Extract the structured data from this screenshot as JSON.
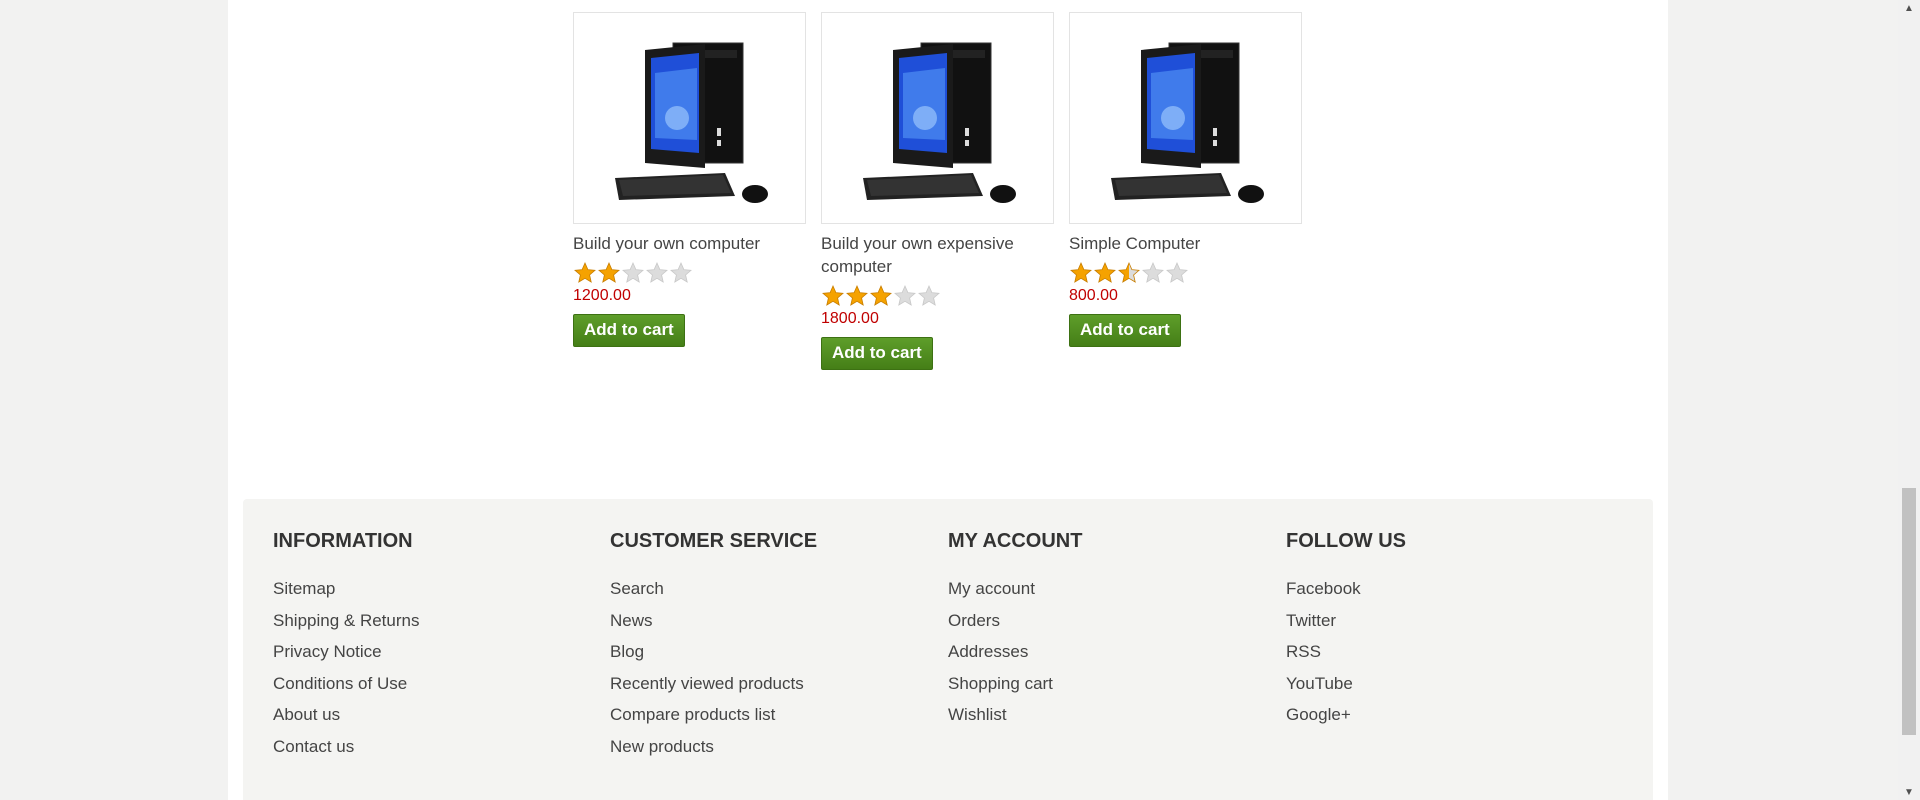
{
  "products": [
    {
      "title": "Build your own computer",
      "rating_fraction": 0.4,
      "price": "1200.00",
      "add_label": "Add to cart"
    },
    {
      "title": "Build your own expensive computer",
      "rating_fraction": 0.6,
      "price": "1800.00",
      "add_label": "Add to cart"
    },
    {
      "title": "Simple Computer",
      "rating_fraction": 0.5,
      "price": "800.00",
      "add_label": "Add to cart"
    }
  ],
  "footer": {
    "columns": [
      {
        "heading": "INFORMATION",
        "links": [
          "Sitemap",
          "Shipping & Returns",
          "Privacy Notice",
          "Conditions of Use",
          "About us",
          "Contact us"
        ]
      },
      {
        "heading": "CUSTOMER SERVICE",
        "links": [
          "Search",
          "News",
          "Blog",
          "Recently viewed products",
          "Compare products list",
          "New products"
        ]
      },
      {
        "heading": "MY ACCOUNT",
        "links": [
          "My account",
          "Orders",
          "Addresses",
          "Shopping cart",
          "Wishlist"
        ]
      },
      {
        "heading": "FOLLOW US",
        "links": [
          "Facebook",
          "Twitter",
          "RSS",
          "YouTube",
          "Google+"
        ]
      }
    ]
  },
  "colors": {
    "price": "#c00000",
    "button": "#4e8c1f",
    "star_filled": "#f5a200",
    "star_empty": "#dcdcdc"
  }
}
